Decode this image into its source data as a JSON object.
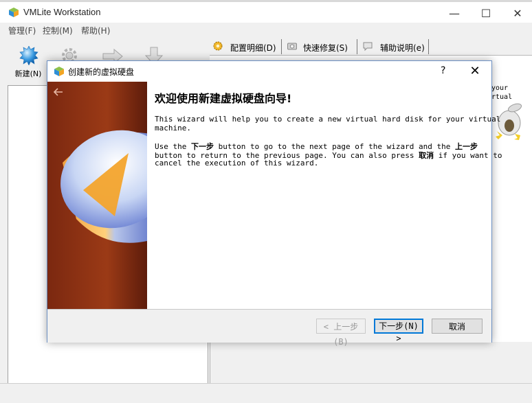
{
  "window": {
    "title": "VMLite Workstation",
    "controls": {
      "minimize": "—",
      "maximize": "☐",
      "close": "✕"
    }
  },
  "menu": [
    {
      "label": "管理(F)"
    },
    {
      "label": "控制(M)"
    },
    {
      "label": "帮助(H)"
    }
  ],
  "toolbar": {
    "new_label": "新建(N)"
  },
  "tabs": [
    {
      "label": "配置明细(D)",
      "icon": "gear-icon"
    },
    {
      "label": "快速修复(S)",
      "icon": "camera-icon"
    },
    {
      "label": "辅助说明(e)",
      "icon": "speech-bubble-icon"
    }
  ],
  "right_panel": {
    "partial_text_1": "your",
    "partial_text_2": "rtual"
  },
  "dialog": {
    "title": "创建新的虚拟硬盘",
    "help": "?",
    "close": "✕",
    "heading": "欢迎使用新建虚拟硬盘向导!",
    "para1_line1": "This wizard will help you to create a new virtual hard disk for your virtual",
    "para1_line2": "machine.",
    "para2_line1_a": "Use the ",
    "para2_line1_next": "下一步",
    "para2_line1_b": " button to go to the next page of the wizard and the ",
    "para2_line1_prev": "上一步",
    "para2_line2_a": "button to return to the previous page. You can also press ",
    "para2_line2_cancel": "取消",
    "para2_line2_b": " if you want to",
    "para2_line3": "cancel the execution of this wizard.",
    "buttons": {
      "back": "< 上一步(B)",
      "next": "下一步(N) >",
      "cancel": "取消"
    }
  },
  "colors": {
    "accent": "#0078d7",
    "dialog_border": "#6b8fc2",
    "image_bg": "#8a3113"
  }
}
